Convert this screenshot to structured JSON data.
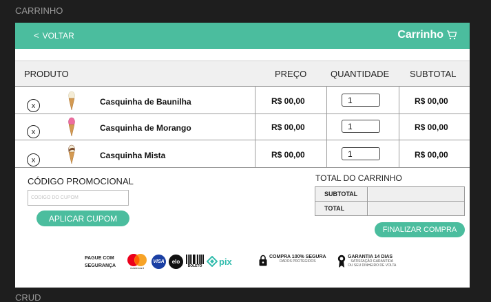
{
  "canvas": {
    "top_label": "CARRINHO",
    "bottom_label": "CRUD"
  },
  "header": {
    "back_label": "VOLTAR",
    "title": "Carrinho"
  },
  "table": {
    "headers": {
      "product": "PRODUTO",
      "price": "PREÇO",
      "quantity": "QUANTIDADE",
      "subtotal": "SUBTOTAL"
    },
    "rows": [
      {
        "remove": "x",
        "name": "Casquinha de Baunilha",
        "price": "R$ 00,00",
        "qty": "1",
        "subtotal": "R$ 00,00",
        "icon": "vanilla-cone-icon"
      },
      {
        "remove": "x",
        "name": "Casquinha de Morango",
        "price": "R$ 00,00",
        "qty": "1",
        "subtotal": "R$ 00,00",
        "icon": "strawberry-cone-icon"
      },
      {
        "remove": "x",
        "name": "Casquinha Mista",
        "price": "R$ 00,00",
        "qty": "1",
        "subtotal": "R$ 00,00",
        "icon": "mixed-cone-icon"
      }
    ]
  },
  "promo": {
    "title": "CÓDIGO PROMOCIONAL",
    "placeholder": "CODIGO DO CUPOM",
    "apply_label": "APLICAR CUPOM"
  },
  "totals": {
    "title": "TOTAL DO CARRINHO",
    "subtotal_label": "SUBTOTAL",
    "total_label": "TOTAL",
    "subtotal_value": "",
    "total_value": ""
  },
  "checkout_label": "FINALIZAR COMPRA",
  "footer": {
    "pay_label_line1": "PAGUE COM",
    "pay_label_line2": "SEGURANÇA",
    "mastercard_text": "mastercard",
    "visa_text": "VISA",
    "elo_text": "elo",
    "boleto_text": "BOLETO",
    "pix_text": "pix",
    "secure_title": "COMPRA 100% SEGURA",
    "secure_sub": "DADOS PROTEGIDOS",
    "guarantee_title": "GARANTIA 14 DIAS",
    "guarantee_sub1": "SATISFAÇÃO GARANTIDA",
    "guarantee_sub2": "OU SEU DINHEIRO DE VOLTA"
  },
  "colors": {
    "accent": "#4bbd9e",
    "background": "#1e1e1e"
  }
}
